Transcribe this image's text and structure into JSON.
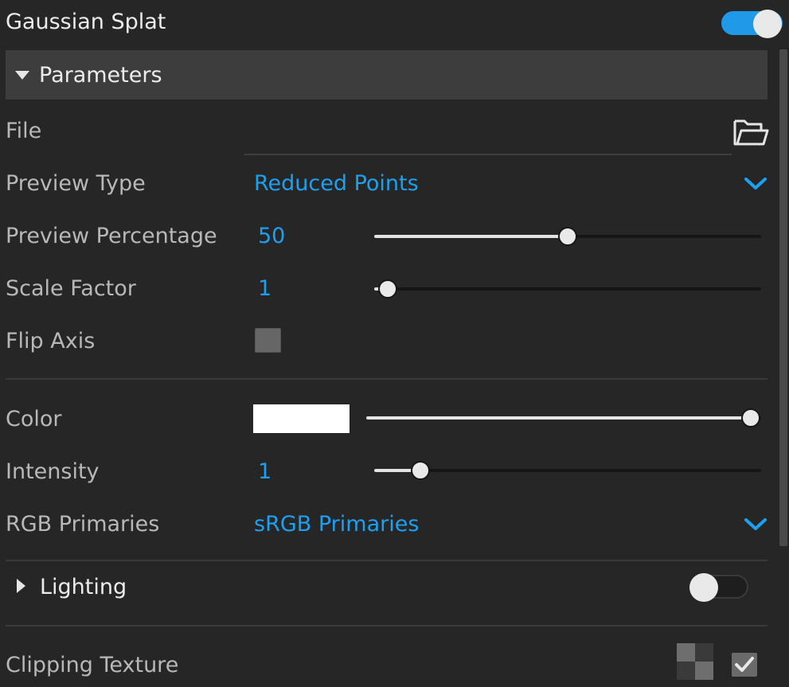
{
  "header": {
    "title": "Gaussian Splat",
    "enabled": true
  },
  "parameters": {
    "section_label": "Parameters",
    "file": {
      "label": "File",
      "value": ""
    },
    "preview_type": {
      "label": "Preview Type",
      "value": "Reduced Points"
    },
    "preview_percentage": {
      "label": "Preview Percentage",
      "value": "50",
      "slider_fraction": 0.5
    },
    "scale_factor": {
      "label": "Scale Factor",
      "value": "1",
      "slider_fraction": 0.035
    },
    "flip_axis": {
      "label": "Flip Axis",
      "checked": false
    },
    "color": {
      "label": "Color",
      "swatch": "#ffffff",
      "slider_fraction": 1.0
    },
    "intensity": {
      "label": "Intensity",
      "value": "1",
      "slider_fraction": 0.12
    },
    "rgb_primaries": {
      "label": "RGB Primaries",
      "value": "sRGB Primaries"
    }
  },
  "lighting": {
    "section_label": "Lighting",
    "enabled": false
  },
  "clipping_texture": {
    "label": "Clipping Texture",
    "checked": true
  },
  "icons": {
    "folder": "folder-open-icon",
    "dropdown": "chevron-down-icon",
    "texture": "checkerboard-texture-icon",
    "checkmark": "checkmark-icon"
  },
  "colors": {
    "accent": "#1ea0f0",
    "toggle_on": "#1e9ae8",
    "background": "#262626",
    "section_bar": "#3d3d3d"
  }
}
